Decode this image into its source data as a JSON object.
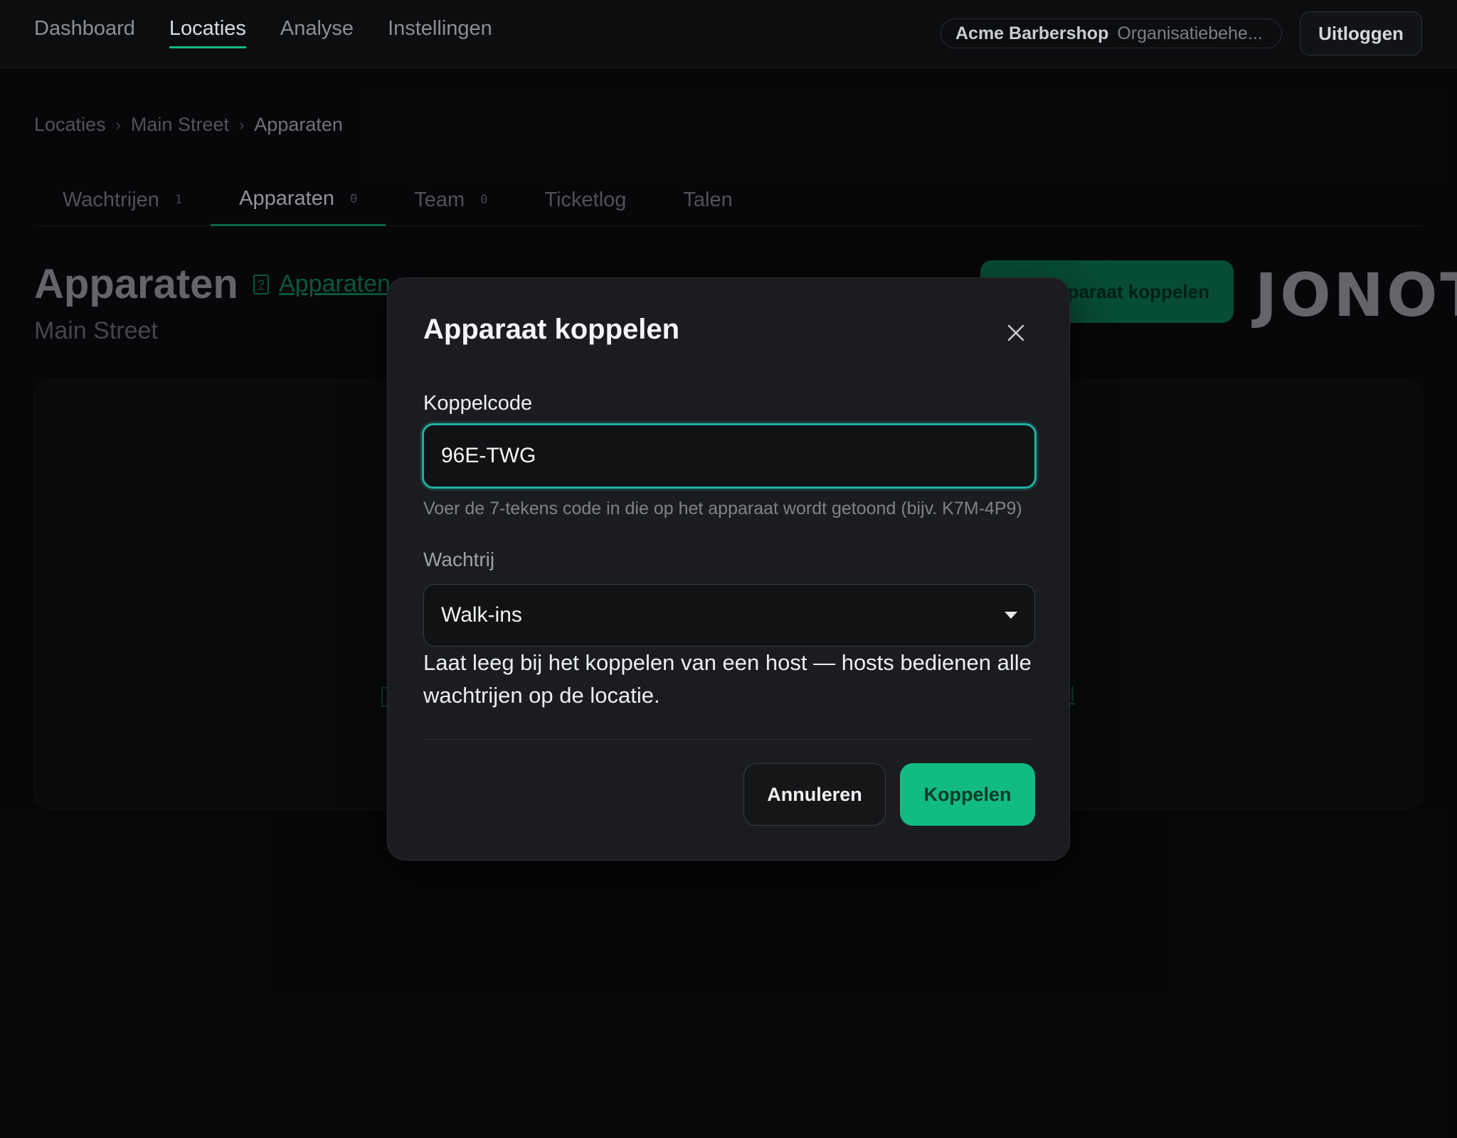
{
  "nav": {
    "links": [
      {
        "label": "Dashboard"
      },
      {
        "label": "Locaties"
      },
      {
        "label": "Analyse"
      },
      {
        "label": "Instellingen"
      }
    ],
    "active": "Locaties",
    "org_name": "Acme Barbershop",
    "org_role": "Organisatiebehe...",
    "logout_label": "Uitloggen"
  },
  "breadcrumb": [
    "Locaties",
    "Main Street",
    "Apparaten"
  ],
  "tabs": [
    {
      "label": "Wachtrijen",
      "count": "1"
    },
    {
      "label": "Apparaten",
      "count": "0"
    },
    {
      "label": "Team",
      "count": "0"
    },
    {
      "label": "Ticketlog",
      "count": ""
    },
    {
      "label": "Talen",
      "count": ""
    }
  ],
  "page": {
    "title": "Apparaten",
    "help_link": "Apparaten",
    "subtitle": "Main Street",
    "pair_button": "paraat koppelen",
    "brand_logo": "JONOT"
  },
  "modal": {
    "title": "Apparaat koppelen",
    "code_label": "Koppelcode",
    "code_value": "96E-TWG",
    "code_hint": "Voer de 7-tekens code in die op het apparaat wordt getoond (bijv. K7M-4P9)",
    "queue_label": "Wachtrij",
    "queue_value": "Walk-ins",
    "queue_hint": "Laat leeg bij het koppelen van een host — hosts bedienen alle wachtrijen op de locatie.",
    "cancel_label": "Annuleren",
    "submit_label": "Koppelen"
  },
  "colors": {
    "accent": "#12bb82",
    "focus_ring": "#1fb0a2",
    "background": "#0a0b0d",
    "modal_bg": "#1a1c1f"
  }
}
